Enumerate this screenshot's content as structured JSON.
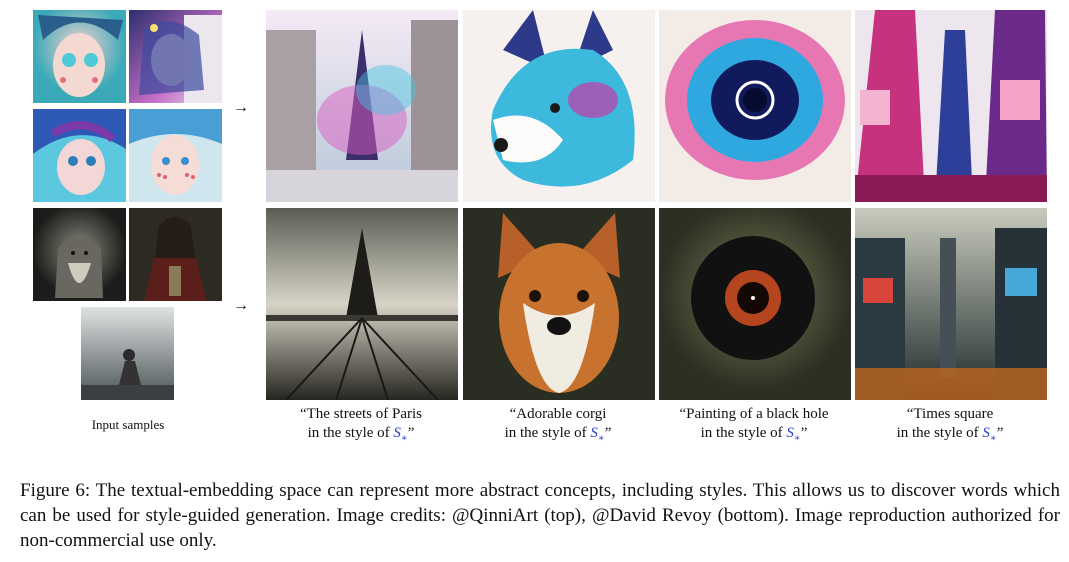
{
  "input_label": "Input samples",
  "arrow": "→",
  "captions": [
    {
      "line1": "“The streets of Paris",
      "line2_prefix": "in the style of ",
      "symbol": "S",
      "subscript": "∗",
      "suffix": "”"
    },
    {
      "line1": "“Adorable corgi",
      "line2_prefix": "in the style of ",
      "symbol": "S",
      "subscript": "∗",
      "suffix": "”"
    },
    {
      "line1": "“Painting of a black hole",
      "line2_prefix": "in the style of ",
      "symbol": "S",
      "subscript": "∗",
      "suffix": "”"
    },
    {
      "line1": "“Times square",
      "line2_prefix": "in the style of ",
      "symbol": "S",
      "subscript": "∗",
      "suffix": "”"
    }
  ],
  "figure_caption": "Figure 6: The textual-embedding space can represent more abstract concepts, including styles. This allows us to discover words which can be used for style-guided generation. Image credits: @QinniArt (top), @David Revoy (bottom). Image reproduction authorized for non-commercial use only.",
  "colors": {
    "symbol": "#2b3fd6"
  }
}
